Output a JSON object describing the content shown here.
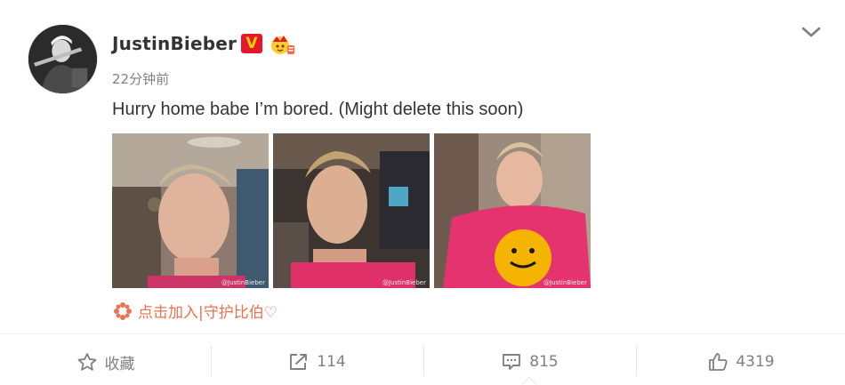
{
  "post": {
    "username": "JustinBieber",
    "vip_badge": "V",
    "timestamp": "22分钟前",
    "text": "Hurry home babe I’m bored. (Might delete this soon)",
    "photos": [
      {
        "watermark": "@JustinBieber"
      },
      {
        "watermark": "@JustinBieber"
      },
      {
        "watermark": "@JustinBieber"
      }
    ],
    "promo_link": "点击加入|守护比伯♡"
  },
  "actions": {
    "favorite_label": "收藏",
    "repost_count": "114",
    "comment_count": "815",
    "like_count": "4319"
  },
  "icons": {
    "avatar": "avatar",
    "vip": "verified-v-icon",
    "crown": "crown-icon",
    "chevron": "chevron-down-icon",
    "promo": "flower-icon",
    "favorite": "star-icon",
    "repost": "repost-icon",
    "comment": "comment-icon",
    "like": "thumbs-up-icon"
  },
  "colors": {
    "accent_orange": "#eb7350",
    "vip_red": "#e6162d",
    "vip_gold": "#ffd200",
    "muted_text": "#808080",
    "body_text": "#333333"
  }
}
